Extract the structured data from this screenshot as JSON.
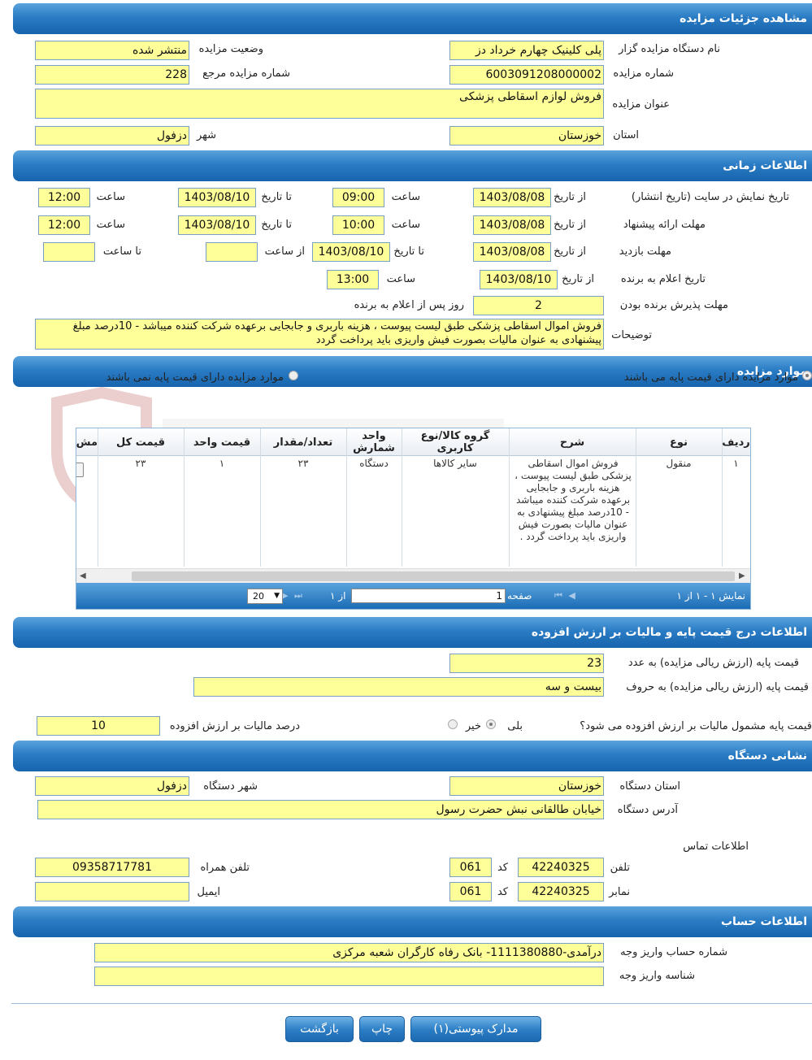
{
  "sections": {
    "details": "مشاهده جزئیات مزایده",
    "timing": "اطلاعات زمانی",
    "items": "موارد مزایده",
    "price": "اطلاعات درج قیمت پایه و مالیات بر ارزش افزوده",
    "address": "نشانی دستگاه",
    "account": "اطلاعات حساب"
  },
  "details": {
    "org_label": "نام دستگاه مزایده گزار",
    "org_value": "پلی کلینیک چهارم خرداد دز",
    "status_label": "وضعیت مزایده",
    "status_value": "منتشر شده",
    "number_label": "شماره مزایده",
    "number_value": "6003091208000002",
    "ref_label": "شماره مزایده مرجع",
    "ref_value": "228",
    "title_label": "عنوان مزایده",
    "title_value": "فروش لوازم اسقاطی پزشکی",
    "province_label": "استان",
    "province_value": "خوزستان",
    "city_label": "شهر",
    "city_value": "دزفول"
  },
  "timing": {
    "from_date": "از تاریخ",
    "to_date": "تا تاریخ",
    "time": "ساعت",
    "from_time": "از ساعت",
    "to_time": "تا ساعت",
    "display_label": "تاریخ نمایش در سایت (تاریخ انتشار)",
    "display_from": "1403/08/08",
    "display_from_time": "09:00",
    "display_to": "1403/08/10",
    "display_to_time": "12:00",
    "offer_label": "مهلت ارائه پیشنهاد",
    "offer_from": "1403/08/08",
    "offer_from_time": "10:00",
    "offer_to": "1403/08/10",
    "offer_to_time": "12:00",
    "visit_label": "مهلت بازدید",
    "visit_from": "1403/08/08",
    "visit_to": "1403/08/10",
    "announce_label": "تاریخ اعلام به برنده",
    "announce_from": "1403/08/10",
    "announce_time": "13:00",
    "accept_label": "مهلت پذیرش برنده بودن",
    "accept_value": "2",
    "accept_suffix": "روز پس از اعلام به برنده",
    "desc_label": "توضیحات",
    "desc_value": "فروش اموال اسقاطی پزشکی طبق لیست پیوست ، هزینه باربری و جابجایی برعهده شرکت کننده میباشد - 10درصد مبلغ پیشنهادی به عنوان مالیات بصورت فیش واریزی باید پرداخت گردد"
  },
  "items": {
    "radio_with_price": "موارد مزایده دارای قیمت پایه می باشند",
    "radio_without_price": "موارد مزایده دارای قیمت پایه نمی باشند",
    "headers": [
      "ردیف",
      "نوع",
      "شرح",
      "گروه کالا/نوع کاربری",
      "واحد شمارش",
      "تعداد/مقدار",
      "قیمت واحد",
      "قیمت کل",
      "مش"
    ],
    "row": {
      "index": "۱",
      "type": "منقول",
      "desc": "فروش اموال اسقاطی پزشکی طبق لیست پیوست ، هزینه باربری و جابجایی برعهده شرکت کننده میباشد - 10درصد مبلغ پیشنهادی به عنوان مالیات بصورت فیش واریزی باید پرداخت گردد .",
      "group": "سایر کالاها",
      "unit": "دستگاه",
      "qty": "۲۳",
      "unit_price": "۱",
      "total": "۲۳"
    },
    "pager": {
      "showing": "نمایش ۱ - ۱ از ۱",
      "page": "صفحه",
      "page_value": "1",
      "of": "از ۱",
      "size": "20"
    }
  },
  "price": {
    "num_label": "قیمت پایه (ارزش ریالی مزایده) به عدد",
    "num_value": "23",
    "words_label": "قیمت پایه (ارزش ریالی مزایده) به حروف",
    "words_value": "بیست و سه",
    "vat_question": "قیمت پایه مشمول مالیات بر ارزش افزوده می شود؟",
    "yes": "بلی",
    "no": "خیر",
    "vat_percent_label": "درصد مالیات بر ارزش افزوده",
    "vat_percent_value": "10"
  },
  "address": {
    "province_label": "استان دستگاه",
    "province_value": "خوزستان",
    "city_label": "شهر دستگاه",
    "city_value": "دزفول",
    "addr_label": "آدرس دستگاه",
    "addr_value": "خیابان طالقانی نبش حضرت رسول",
    "contact_label": "اطلاعات تماس",
    "phone_label": "تلفن",
    "phone_value": "42240325",
    "code_label": "کد",
    "phone_code": "061",
    "mobile_label": "تلفن همراه",
    "mobile_value": "09358717781",
    "fax_label": "نمابر",
    "fax_value": "42240325",
    "fax_code": "061",
    "email_label": "ایمیل",
    "email_value": ""
  },
  "account": {
    "acc_label": "شماره حساب واریز وجه",
    "acc_value": "درآمدی-1111380880- بانک رفاه کارگران شعبه مرکزی",
    "id_label": "شناسه واریز وجه",
    "id_value": ""
  },
  "buttons": {
    "attachments": "مدارک پیوستی(۱)",
    "print": "چاپ",
    "back": "بازگشت"
  },
  "colors": {
    "header": "#1664ad",
    "field": "#ffff99"
  }
}
